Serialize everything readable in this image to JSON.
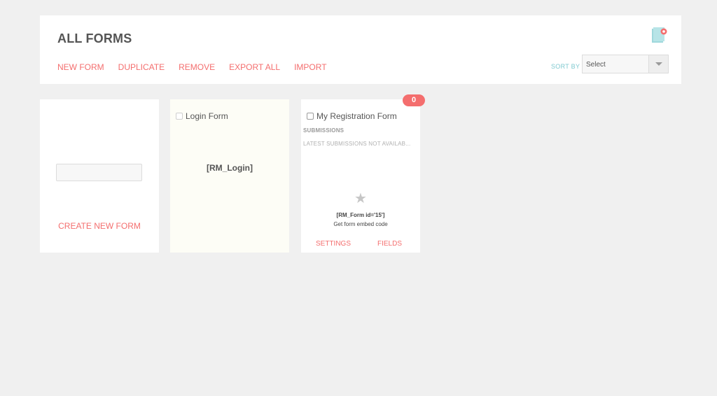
{
  "header": {
    "title": "ALL FORMS",
    "actions": [
      {
        "label": "NEW FORM"
      },
      {
        "label": "DUPLICATE"
      },
      {
        "label": "REMOVE"
      },
      {
        "label": "EXPORT ALL"
      },
      {
        "label": "IMPORT"
      }
    ],
    "sort": {
      "label": "SORT BY",
      "selected": "Select"
    },
    "icon": "form-document-icon"
  },
  "cards": {
    "new_form": {
      "input_value": "",
      "create_label": "CREATE NEW FORM"
    },
    "login": {
      "title": "Login Form",
      "shortcode": "[RM_Login]"
    },
    "registration": {
      "title": "My Registration Form",
      "badge": "0",
      "submissions_label": "SUBMISSIONS",
      "submissions_status": "LATEST SUBMISSIONS NOT AVAILAB...",
      "star_icon": "star-icon",
      "shortcode": "[RM_Form id='15']",
      "embed_label": "Get form embed code",
      "settings_label": "SETTINGS",
      "fields_label": "FIELDS"
    }
  },
  "colors": {
    "accent": "#f46e6e",
    "sort_label": "#7fc9d0",
    "background": "#f0f0f0",
    "login_card": "#fdfdf6"
  }
}
